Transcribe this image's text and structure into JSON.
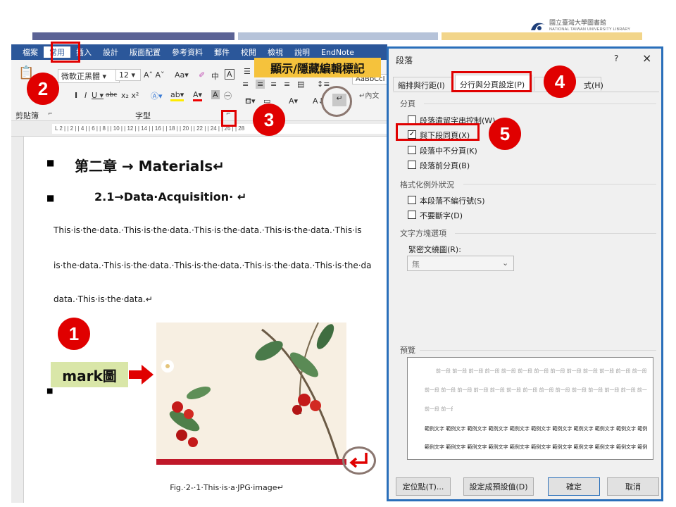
{
  "header": {
    "strip_colors": [
      "#5b6395",
      "#b6c3d9",
      "#f2d58a"
    ],
    "logo_zh": "國立臺灣大學圖書館",
    "logo_en": "NATIONAL TAIWAN UNIVERSITY LIBRARY"
  },
  "ribbon": {
    "tabs": [
      "檔案",
      "常用",
      "插入",
      "設計",
      "版面配置",
      "參考資料",
      "郵件",
      "校閱",
      "檢視",
      "說明",
      "EndNote"
    ],
    "active_tab": "常用",
    "font_name": "微軟正黑體",
    "font_size": "12",
    "style_preview": "AaBbCcI",
    "style_name": "↵內文",
    "group_clipboard": "剪貼簿",
    "group_font": "字型",
    "ruler_text": "L   2 |     |  2 |  | 4 |  | 6 |  | 8 |  | 10 |  | 12 |  | 14 |  | 16 |  | 18 |  | 20 |  | 22 |  | 24 |  | 26 |  | 28"
  },
  "callouts": {
    "c1": "1",
    "c2": "2",
    "c3": "3",
    "c4": "4",
    "c5": "5",
    "show_hide_label": "顯示/隱藏編輯標記",
    "mark_label": "mark圖"
  },
  "document": {
    "chapter_title": "第二章 → Materials↵",
    "section_title": "2.1→Data·Acquisition· ↵",
    "line1": "This·is·the·data.·This·is·the·data.·This·is·the·data.·This·is·the·data.·This·is",
    "line2": "is·the·data.·This·is·the·data.·This·is·the·data.·This·is·the·data.·This·is·the·da",
    "line3": "data.·This·is·the·data.↵",
    "caption": "Fig.·2-·1·This·is·a·JPG·image↵"
  },
  "dialog": {
    "title": "段落",
    "help": "?",
    "close": "×",
    "tab1": "縮排與行距(I)",
    "tab2": "分行與分頁設定(P)",
    "tab3": "式(H)",
    "section_pagination": "分頁",
    "opt_widow": "段落遺留字串控制(W)",
    "opt_keep_next": "與下段同頁(X)",
    "opt_keep_lines": "段落中不分頁(K)",
    "opt_page_before": "段落前分頁(B)",
    "section_exceptions": "格式化例外狀況",
    "opt_suppress_numbers": "本段落不編行號(S)",
    "opt_no_hyphen": "不要斷字(D)",
    "section_textbox": "文字方塊選項",
    "tight_wrap_label": "緊密文繞圖(R):",
    "tight_wrap_value": "無",
    "section_preview": "預覽",
    "preview_prev": "前一段 前一段 前一段 前一段 前一段 前一段 前一段 前一段 前一段 前一段 前一段 前一段 前一段 前一段 前一段 前一段 前一段 前一段 前一段 前一段 前一段 前一段 前一段 前一段",
    "preview_sample": "範例文字 範例文字 範例文字 範例文字 範例文字 範例文字 範例文字 範例文字 範例文字 範例文字 範例文字 範例文字 範例文字 範例文字 範例文字 範例文字 範例文字 範例文字",
    "btn_tabs": "定位點(T)...",
    "btn_default": "設定成預設值(D)",
    "btn_ok": "確定",
    "btn_cancel": "取消"
  }
}
